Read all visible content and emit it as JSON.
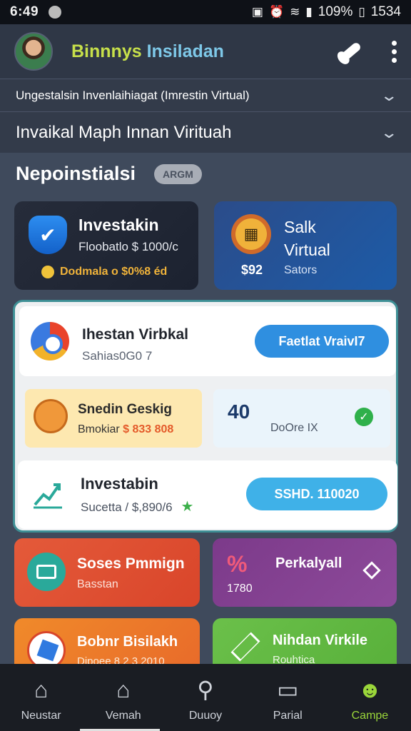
{
  "status_bar": {
    "time": "6:49",
    "battery": "109%",
    "clock_right": "1534"
  },
  "header": {
    "title_part1": "Binnnys",
    "title_part2": "Insiladan"
  },
  "subheader": {
    "line1": "Ungestalsin Invenlaihiagat (Imrestin Virtual)",
    "line2": "Invaikal Maph Innan Virituah"
  },
  "section": {
    "title": "Nepoinstialsi",
    "badge": "ARGM"
  },
  "cards_top": [
    {
      "title": "Investakin",
      "subtitle": "Floobatlo $ 1000/c",
      "footer": "Dodmala o $0%8 éd"
    },
    {
      "title": "Salk",
      "title2": "Virtual",
      "value": "$92",
      "footer": "Sators"
    }
  ],
  "featured": {
    "row1": {
      "title": "Ihestan Virbkal",
      "subtitle": "Sahias0G0   7",
      "button": "Faetlat VraivI7"
    },
    "tile_yellow": {
      "title": "Snedin Geskig",
      "subtitle_prefix": "Bmokiar",
      "amount": "$ 833 808"
    },
    "tile_blue": {
      "value": "40",
      "subtitle": "DoOre IX"
    },
    "row3": {
      "title": "Investabin",
      "subtitle": "Sucetta / $,890/6",
      "button": "SSHD. 110020"
    }
  },
  "cards_bottom": [
    {
      "title": "Soses Pmmign",
      "subtitle": "Basstan"
    },
    {
      "pct": "%",
      "title": "Perkalyall",
      "subtitle": "1780"
    },
    {
      "title": "Bobnr Bisilakh",
      "subtitle": "Dipoee 8 2 3 2010"
    },
    {
      "title": "Nihdan Virkile",
      "subtitle": "Rouhtica"
    }
  ],
  "bottom_nav": [
    {
      "label": "Neustar",
      "icon": "home-icon"
    },
    {
      "label": "Vemah",
      "icon": "house-icon"
    },
    {
      "label": "Duuoy",
      "icon": "search-icon"
    },
    {
      "label": "Parial",
      "icon": "chat-icon"
    },
    {
      "label": "Campe",
      "icon": "profile-icon"
    }
  ],
  "colors": {
    "accent_green": "#9ad63a",
    "button_blue": "#2f8fe0",
    "title_yellow": "#c7e04a"
  }
}
